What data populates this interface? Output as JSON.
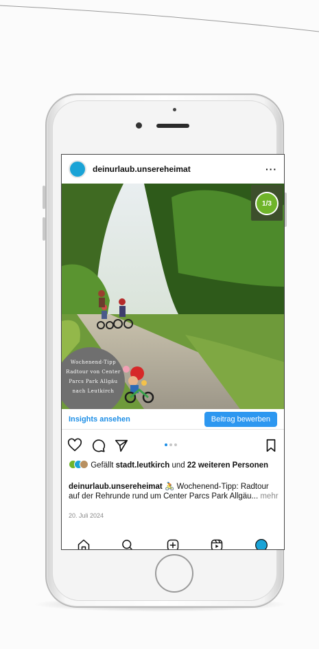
{
  "post": {
    "username": "deinurlaub.unsereheimat",
    "more_label": "···",
    "carousel_counter": "1/3",
    "overlay_lines": [
      "Wochenend-Tipp",
      "Radtour von Center",
      "Parcs Park Allgäu",
      "nach Leutkirch"
    ],
    "insights_label": "Insights ansehen",
    "promote_label": "Beitrag bewerben",
    "likes_prefix": "Gefällt ",
    "likes_user": "stadt.leutkirch",
    "likes_middle": " und ",
    "likes_others": "22 weiteren Personen",
    "caption_user": "deinurlaub.unsereheimat",
    "caption_emoji": "🚴",
    "caption_text": " Wochenend-Tipp: Radtour auf der Rehrunde rund um Center Parcs Park Allgäu...",
    "caption_more": " mehr",
    "date": "20. Juli 2024",
    "carousel_position": 1,
    "carousel_total": 3
  },
  "icons": {
    "action_bar": [
      "heart-icon",
      "comment-icon",
      "send-icon",
      "bookmark-icon"
    ],
    "nav_bar": [
      "home-icon",
      "search-icon",
      "create-icon",
      "reels-icon",
      "profile-icon"
    ]
  },
  "colors": {
    "accent": "#1a8de6",
    "button": "#2d97f0",
    "avatar": "#1aa3d6"
  }
}
